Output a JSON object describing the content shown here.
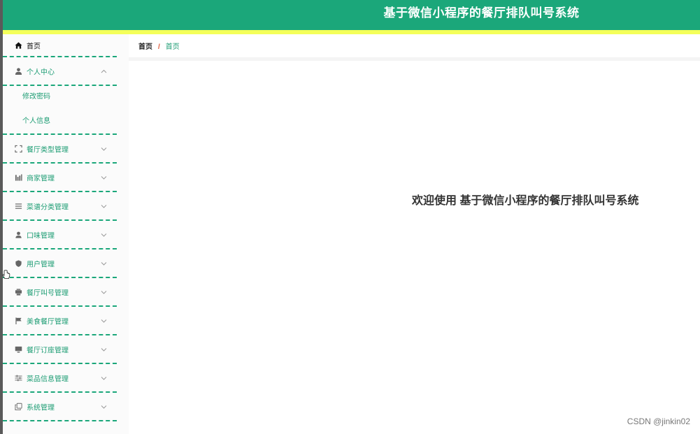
{
  "header": {
    "title": "基于微信小程序的餐厅排队叫号系统"
  },
  "colors": {
    "accent": "#1ba77a",
    "stripe": "#f4ff5a",
    "breadcrumb_sep": "#e05c3b"
  },
  "sidebar": {
    "home": {
      "label": "首页",
      "icon": "home-icon"
    },
    "personal": {
      "label": "个人中心",
      "icon": "user-icon",
      "children": [
        "修改密码",
        "个人信息"
      ]
    },
    "items": [
      {
        "label": "餐厅类型管理",
        "icon": "fullscreen-icon"
      },
      {
        "label": "商家管理",
        "icon": "bar-chart-icon"
      },
      {
        "label": "菜谱分类管理",
        "icon": "list-icon"
      },
      {
        "label": "口味管理",
        "icon": "person-icon"
      },
      {
        "label": "用户管理",
        "icon": "shield-icon"
      },
      {
        "label": "餐厅叫号管理",
        "icon": "printer-icon"
      },
      {
        "label": "美食餐厅管理",
        "icon": "flag-icon"
      },
      {
        "label": "餐厅订座管理",
        "icon": "monitor-icon"
      },
      {
        "label": "菜品信息管理",
        "icon": "sliders-icon"
      },
      {
        "label": "系统管理",
        "icon": "copy-icon"
      }
    ]
  },
  "breadcrumb": {
    "home": "首页",
    "separator": "/",
    "current": "首页"
  },
  "main": {
    "welcome": "欢迎使用 基于微信小程序的餐厅排队叫号系统"
  },
  "watermark": "CSDN @jinkin02"
}
